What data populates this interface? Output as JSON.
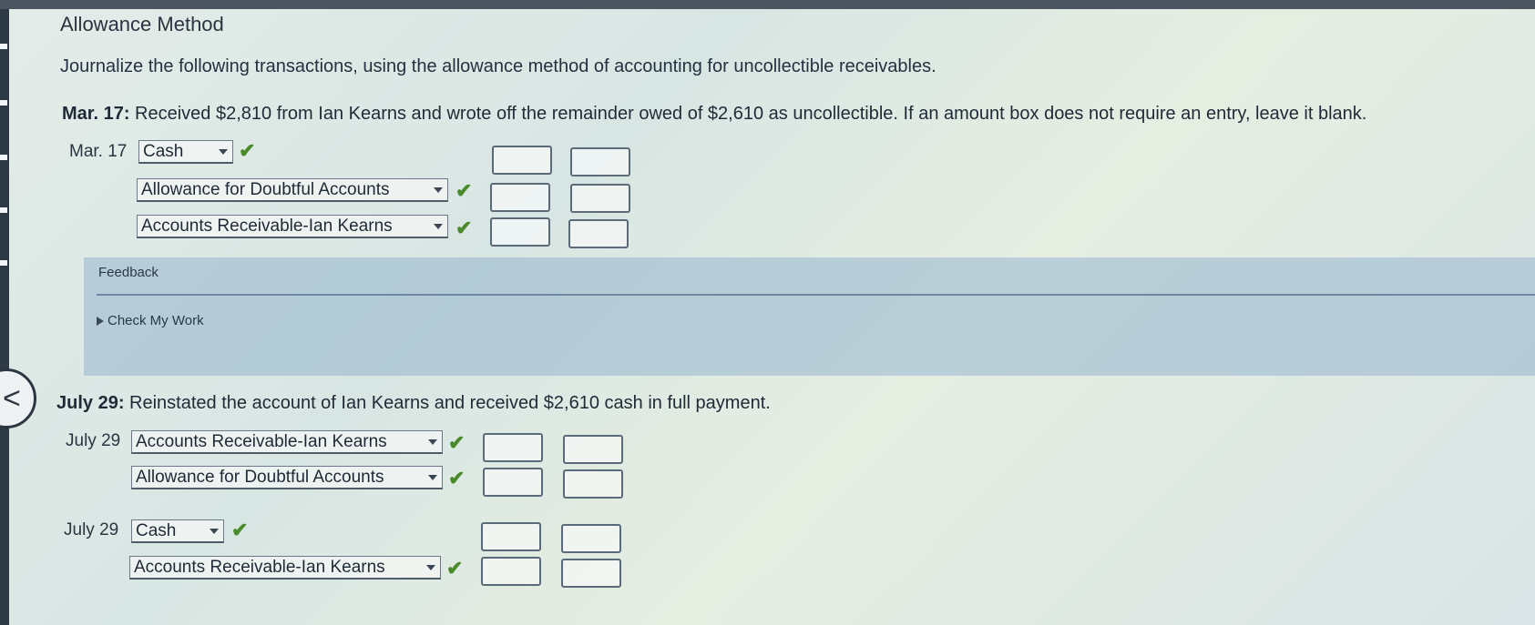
{
  "title": "Allowance Method",
  "instructions": "Journalize the following transactions, using the allowance method of accounting for uncollectible receivables.",
  "q1": {
    "label": "Mar. 17:",
    "text": "Received $2,810 from Ian Kearns and wrote off the remainder owed of $2,610 as uncollectible. If an amount box does not require an entry, leave it blank.",
    "date": "Mar. 17",
    "accounts": [
      "Cash",
      "Allowance for Doubtful Accounts",
      "Accounts Receivable-Ian Kearns"
    ]
  },
  "feedback": {
    "title": "Feedback",
    "check_my_work": "Check My Work"
  },
  "q2": {
    "label": "July 29:",
    "text": "Reinstated the account of Ian Kearns and received $2,610 cash in full payment.",
    "entry1": {
      "date": "July 29",
      "accounts": [
        "Accounts Receivable-Ian Kearns",
        "Allowance for Doubtful Accounts"
      ]
    },
    "entry2": {
      "date": "July 29",
      "accounts": [
        "Cash",
        "Accounts Receivable-Ian Kearns"
      ]
    }
  },
  "icons": {
    "check": "checkmark-icon",
    "back": "chevron-left-icon"
  },
  "colors": {
    "check_green": "#4b8a2a",
    "feedback_bg": "#96b4cd"
  }
}
